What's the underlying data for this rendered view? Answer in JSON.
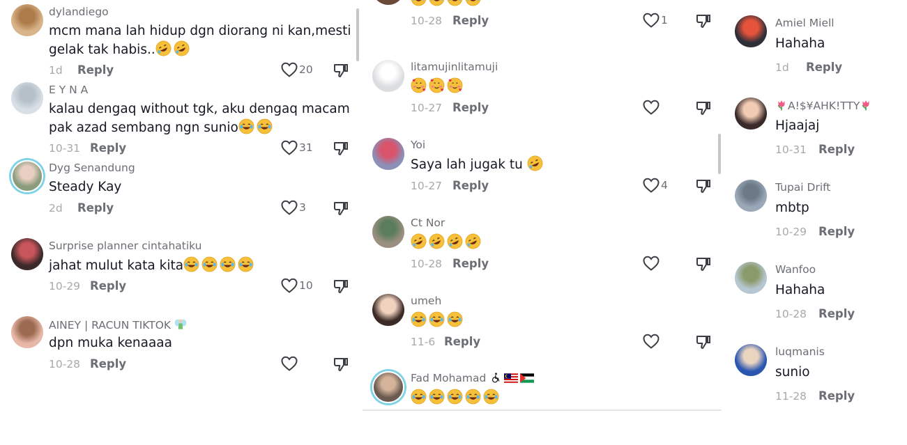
{
  "col1": [
    {
      "username": "dylandiego",
      "text_line1": "mcm mana lah hidup dgn diorang ni kan,mesti",
      "text_line2": "gelak tak habis..",
      "emojis": [
        "rofl",
        "rofl"
      ],
      "date": "1d",
      "reply": "Reply",
      "likes": "20",
      "avatar": "#d9b48a",
      "avatar2": "#ad7b4a"
    },
    {
      "username": "E Y N A",
      "text_line1": "kalau dengaq without tgk, aku dengaq macam",
      "text_line2": "pak azad sembang ngn sunio",
      "emojis": [
        "joy",
        "joy"
      ],
      "date": "10-31",
      "reply": "Reply",
      "likes": "31",
      "avatar": "#d8dfe6",
      "avatar2": "#b6c0c8"
    },
    {
      "username": "Dyg Senandung",
      "text_line1": "Steady Kay",
      "emojis": [],
      "date": "2d",
      "reply": "Reply",
      "likes": "3",
      "avatar": "#8a9c7c",
      "avatar2": "#e8cfc2"
    },
    {
      "username": "Surprise planner cintahatiku",
      "text_line1": "jahat mulut kata kita",
      "emojis": [
        "joy",
        "joy",
        "joy",
        "joy"
      ],
      "date": "10-29",
      "reply": "Reply",
      "likes": "10",
      "avatar": "#3c2a2a",
      "avatar2": "#c8555a"
    },
    {
      "username": "AINEY | RACUN TIKTOK",
      "username_suffix": "fairy",
      "text_line1": "dpn muka kenaaaa",
      "emojis": [],
      "date": "10-28",
      "reply": "Reply",
      "likes": "",
      "avatar": "#e7b8a8",
      "avatar2": "#9b6a50"
    }
  ],
  "col2": [
    {
      "username": "",
      "text_line1": "",
      "emojis": [
        "joy",
        "joy",
        "joy",
        "joy"
      ],
      "date": "10-28",
      "reply": "Reply",
      "likes": "1",
      "avatar": "#6b4a3a",
      "avatar2": "#a8846a"
    },
    {
      "username": "litamujinlitamuji",
      "text_line1": "",
      "emojis": [
        "hearts",
        "hearts",
        "hearts"
      ],
      "date": "10-27",
      "reply": "Reply",
      "likes": "",
      "avatar": "#dcdde0",
      "avatar2": "#ffffff"
    },
    {
      "username": "Yoi",
      "text_line1": "Saya lah jugak tu",
      "emojis": [
        "rofl"
      ],
      "date": "10-27",
      "reply": "Reply",
      "likes": "4",
      "avatar": "#8c8fb6",
      "avatar2": "#d9536b"
    },
    {
      "username": "Ct Nor",
      "text_line1": "",
      "emojis": [
        "rofl",
        "rofl",
        "rofl",
        "rofl"
      ],
      "date": "10-28",
      "reply": "Reply",
      "likes": "",
      "avatar": "#9a8f80",
      "avatar2": "#5c7d5c"
    },
    {
      "username": "umeh",
      "text_line1": "",
      "emojis": [
        "joy",
        "joy",
        "joy"
      ],
      "date": "11-6",
      "reply": "Reply",
      "likes": "",
      "avatar": "#3b2a26",
      "avatar2": "#f0d2bf"
    },
    {
      "username": "Fad Mohamad",
      "username_suffix": "flags",
      "text_line1": "",
      "emojis": [
        "joy",
        "joy",
        "joy",
        "joy",
        "joy"
      ],
      "date": "",
      "reply": "",
      "likes": "",
      "avatar": "#6a5a50",
      "avatar2": "#d4b39a"
    }
  ],
  "col3": [
    {
      "username": "Amiel Miell",
      "text_line1": "Hahaha",
      "date": "1d",
      "reply": "Reply",
      "avatar": "#2f2f3a",
      "avatar2": "#e5533c"
    },
    {
      "username": "A!$¥AHK!TTY",
      "username_decor": "tulip",
      "text_line1": "Hjaajaj",
      "date": "10-31",
      "reply": "Reply",
      "avatar": "#3a2a2a",
      "avatar2": "#f1cbb3"
    },
    {
      "username": "Tupai Drift",
      "text_line1": "mbtp",
      "date": "10-29",
      "reply": "Reply",
      "avatar": "#9aa8b8",
      "avatar2": "#6c7a88"
    },
    {
      "username": "Wanfoo",
      "text_line1": "Hahaha",
      "date": "10-28",
      "reply": "Reply",
      "avatar": "#b7c7d2",
      "avatar2": "#8a9a6a"
    },
    {
      "username": "luqmanis",
      "text_line1": "sunio",
      "date": "11-28",
      "reply": "Reply",
      "avatar": "#2a56b0",
      "avatar2": "#e9d4c0"
    }
  ],
  "colors": {
    "text": "#161823",
    "muted": "#6b6e74",
    "date": "#a7a9ad",
    "icon": "#3b3d44"
  }
}
